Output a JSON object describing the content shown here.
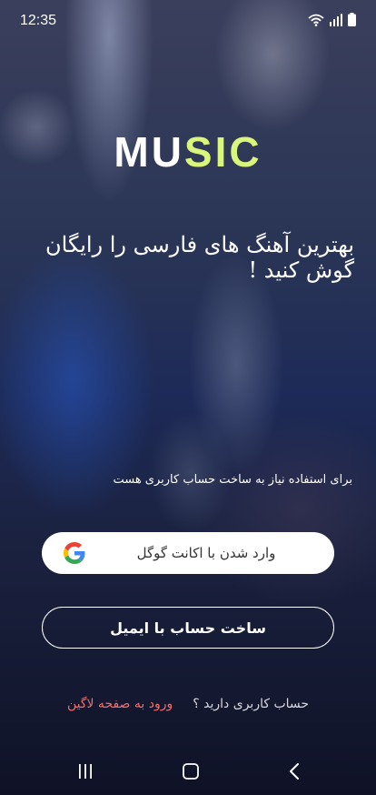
{
  "status_bar": {
    "time": "12:35",
    "icons": [
      "wifi-icon",
      "signal-icon",
      "battery-icon"
    ]
  },
  "logo": {
    "part1": "MU",
    "part2": "SIC",
    "colors": {
      "part1": "#ffffff",
      "part2": "#d9f57a"
    }
  },
  "tagline": "بهترین آهنگ های فارسی را رایگان گوش کنید !",
  "account_note": "برای استفاده نیاز به ساخت حساب کاربری هست",
  "google_button": {
    "label": "وارد شدن با اکانت گوگل",
    "icon": "google-icon"
  },
  "email_button": {
    "label": "ساخت حساب با ایمیل"
  },
  "login_prompt": {
    "question": "حساب کاربری دارید ؟",
    "link": "ورود به صفحه لاگین",
    "link_color": "#ee6f6f"
  },
  "nav_bar": {
    "icons": [
      "recent-apps-icon",
      "home-icon",
      "back-icon"
    ]
  }
}
